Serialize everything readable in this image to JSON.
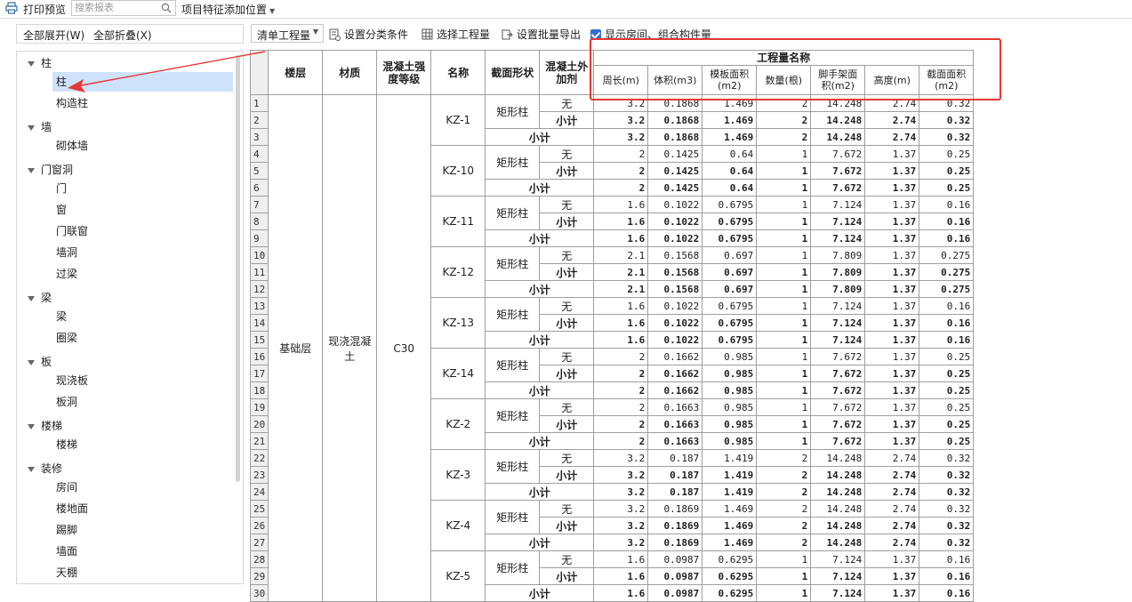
{
  "topbar": {
    "print_label": "打印预览",
    "search_placeholder": "搜索报表",
    "feature_label": "项目特征添加位置"
  },
  "left_toolbar": {
    "expand_all": "全部展开(W)",
    "collapse_all": "全部折叠(X)"
  },
  "tree": [
    {
      "label": "柱",
      "children": [
        "柱",
        "构造柱"
      ]
    },
    {
      "label": "墙",
      "children": [
        "砌体墙"
      ]
    },
    {
      "label": "门窗洞",
      "children": [
        "门",
        "窗",
        "门联窗",
        "墙洞",
        "过梁"
      ]
    },
    {
      "label": "梁",
      "children": [
        "梁",
        "圈梁"
      ]
    },
    {
      "label": "板",
      "children": [
        "现浇板",
        "板洞"
      ]
    },
    {
      "label": "楼梯",
      "children": [
        "楼梯"
      ]
    },
    {
      "label": "装修",
      "children": [
        "房间",
        "楼地面",
        "踢脚",
        "墙面",
        "天棚"
      ]
    }
  ],
  "selected_tree_item": "柱",
  "right_toolbar": {
    "dropdown_value": "清单工程量",
    "set_category": "设置分类条件",
    "select_quantity": "选择工程量",
    "batch_export": "设置批量导出",
    "show_rooms": "显示房间、组合构件量",
    "show_rooms_checked": true
  },
  "table": {
    "headers": {
      "floor": "楼层",
      "material": "材质",
      "grade": "混凝土强度等级",
      "name": "名称",
      "section": "截面形状",
      "additive": "混凝土外加剂",
      "group": "工程量名称",
      "cols": [
        "周长(m)",
        "体积(m3)",
        "模板面积(m2)",
        "数量(根)",
        "脚手架面积(m2)",
        "高度(m)",
        "截面面积(m2)"
      ]
    },
    "floor": "基础层",
    "material": "现浇混凝土",
    "grade": "C30",
    "section_shape": "矩形柱",
    "none_label": "无",
    "subtotal_label": "小计",
    "groups": [
      {
        "name": "KZ-1",
        "values": [
          "3.2",
          "0.1868",
          "1.469",
          "2",
          "14.248",
          "2.74",
          "0.32"
        ]
      },
      {
        "name": "KZ-10",
        "values": [
          "2",
          "0.1425",
          "0.64",
          "1",
          "7.672",
          "1.37",
          "0.25"
        ]
      },
      {
        "name": "KZ-11",
        "values": [
          "1.6",
          "0.1022",
          "0.6795",
          "1",
          "7.124",
          "1.37",
          "0.16"
        ]
      },
      {
        "name": "KZ-12",
        "values": [
          "2.1",
          "0.1568",
          "0.697",
          "1",
          "7.809",
          "1.37",
          "0.275"
        ]
      },
      {
        "name": "KZ-13",
        "values": [
          "1.6",
          "0.1022",
          "0.6795",
          "1",
          "7.124",
          "1.37",
          "0.16"
        ]
      },
      {
        "name": "KZ-14",
        "values": [
          "2",
          "0.1662",
          "0.985",
          "1",
          "7.672",
          "1.37",
          "0.25"
        ]
      },
      {
        "name": "KZ-2",
        "values": [
          "2",
          "0.1663",
          "0.985",
          "1",
          "7.672",
          "1.37",
          "0.25"
        ]
      },
      {
        "name": "KZ-3",
        "values": [
          "3.2",
          "0.187",
          "1.419",
          "2",
          "14.248",
          "2.74",
          "0.32"
        ]
      },
      {
        "name": "KZ-4",
        "values": [
          "3.2",
          "0.1869",
          "1.469",
          "2",
          "14.248",
          "2.74",
          "0.32"
        ]
      },
      {
        "name": "KZ-5",
        "values": [
          "1.6",
          "0.0987",
          "0.6295",
          "1",
          "7.124",
          "1.37",
          "0.16"
        ]
      }
    ]
  }
}
